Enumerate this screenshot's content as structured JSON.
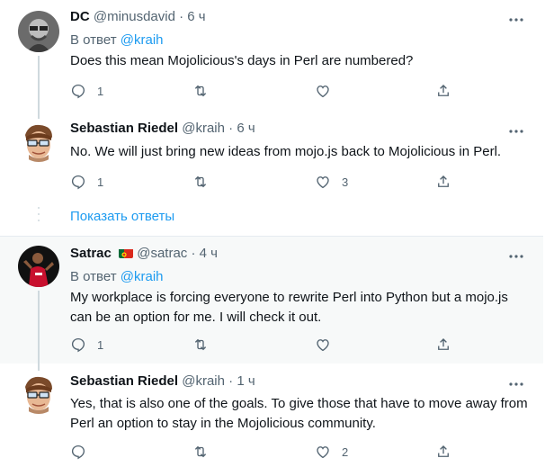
{
  "tweets": [
    {
      "name": "DC",
      "handle": "@minusdavid",
      "time": "6 ч",
      "reply_prefix": "В ответ",
      "reply_mention": "@kraih",
      "text": "Does this mean Mojolicious's days in Perl are numbered?",
      "replies": "1",
      "likes": ""
    },
    {
      "name": "Sebastian Riedel",
      "handle": "@kraih",
      "time": "6 ч",
      "text": "No. We will just bring new ideas from mojo.js back to Mojolicious in Perl.",
      "replies": "1",
      "likes": "3"
    },
    {
      "name": "Satrac",
      "handle": "@satrac",
      "time": "4 ч",
      "reply_prefix": "В ответ",
      "reply_mention": "@kraih",
      "text_line1": "My workplace is forcing everyone to rewrite Perl into Python but a mojo.js",
      "text_line2": "can be an option for me. I will check it out.",
      "replies": "1",
      "likes": ""
    },
    {
      "name": "Sebastian Riedel",
      "handle": "@kraih",
      "time": "1 ч",
      "text_line1": "Yes, that is also one of the goals. To give those that have to move away from",
      "text_line2": "Perl an option to stay in the Mojolicious community.",
      "replies": "",
      "likes": "2"
    }
  ],
  "show_replies": "Показать ответы",
  "separator": "·",
  "more_icon": "more-icon",
  "colors": {
    "link": "#1d9bf0",
    "muted": "#536471",
    "highlight_bg": "#f7f9f9"
  }
}
